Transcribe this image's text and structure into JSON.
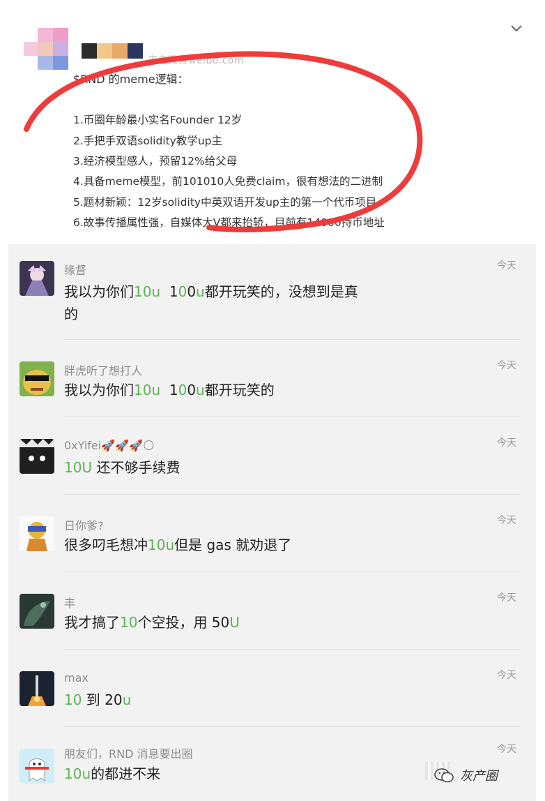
{
  "post": {
    "source_text": "来自微博weibo.com",
    "title": "$RND 的meme逻辑：",
    "lines": [
      "1.币圈年龄最小实名Founder 12岁",
      "2.手把手双语solidity教学up主",
      "3.经济模型感人，预留12%给父母",
      "4.具备meme模型，前101010人免费claim，很有想法的二进制",
      "5.题材新颖：12岁solidity中英双语开发up主的第一个代币项目",
      "6.故事传播属性强，自媒体大V都来抬轿，目前有14000持币地址"
    ]
  },
  "colors": {
    "highlight_green": "#5fb158",
    "annotation_red": "#ee3b3b",
    "panel_bg": "#f2f2f2"
  },
  "comments": [
    {
      "name": "缘督",
      "time": "今天",
      "segs": [
        "我以为你们",
        "10u",
        "  ",
        "100u",
        "都开玩笑的，没想到是真",
        "",
        "的",
        ""
      ]
    },
    {
      "name": "胖虎听了想打人",
      "time": "今天",
      "segs": [
        "我以为你们",
        "10u",
        "  ",
        "100u",
        "都开玩笑的",
        ""
      ]
    },
    {
      "name": "0xYifei🚀🚀🚀🌕",
      "time": "今天",
      "segs": [
        "",
        "10U",
        " 还不够手续费",
        ""
      ]
    },
    {
      "name": "日你爹?",
      "time": "今天",
      "segs": [
        "很多叼毛想冲",
        "10u",
        "但是 gas 就劝退了",
        ""
      ]
    },
    {
      "name": "丰",
      "time": "今天",
      "segs": [
        "我才搞了",
        "10",
        "个空投，用 50",
        "U"
      ]
    },
    {
      "name": "max",
      "time": "今天",
      "segs": [
        "",
        "10",
        " 到 20",
        "u"
      ]
    },
    {
      "name": "朋友们，RND 消息要出圈",
      "time": "今天",
      "segs": [
        "",
        "10u",
        "的都进不来",
        ""
      ]
    }
  ],
  "watermark": "灰产圈"
}
